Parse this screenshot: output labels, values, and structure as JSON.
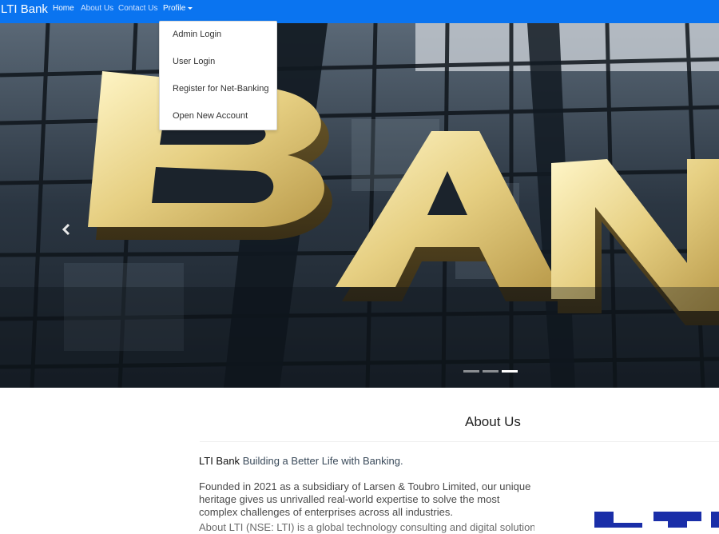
{
  "navbar": {
    "brand": "LTI Bank",
    "links": [
      {
        "label": "Home"
      },
      {
        "label": "About Us"
      },
      {
        "label": "Contact Us"
      },
      {
        "label": "Profile"
      }
    ]
  },
  "dropdown": {
    "items": [
      {
        "label": "Admin Login"
      },
      {
        "label": "User Login"
      },
      {
        "label": "Register for Net-Banking"
      },
      {
        "label": "Open New Account"
      }
    ]
  },
  "hero": {
    "sign_text": "BAN",
    "slide_count": 3,
    "active_slide": 3,
    "prev_icon": "chevron-left-icon"
  },
  "about": {
    "title": "About Us",
    "brand": "LTI Bank",
    "slogan": "Building a Better Life with Banking.",
    "paragraph": "Founded in 2021 as a subsidiary of Larsen & Toubro Limited, our unique heritage gives us unrivalled real-world expertise to solve the most complex challenges of enterprises across all industries.",
    "paragraph2": "About LTI (NSE: LTI) is a global technology consulting and digital solutions company"
  },
  "colors": {
    "navbar": "#0a74f0",
    "logo_blue": "#1a2ea8"
  }
}
